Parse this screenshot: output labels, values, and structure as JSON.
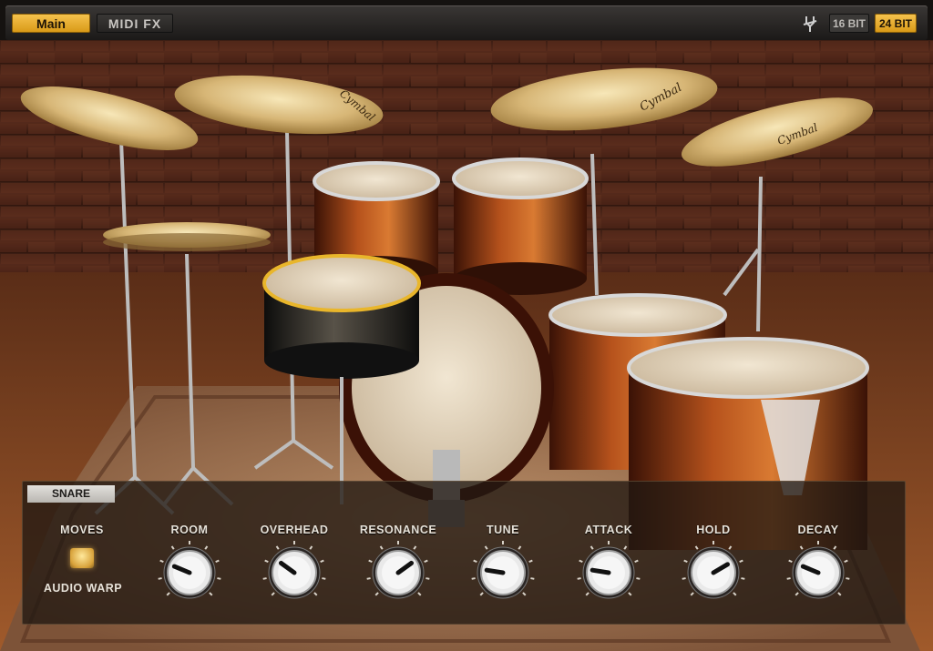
{
  "topbar": {
    "tabs": [
      "Main",
      "MIDI FX"
    ],
    "active_tab": "Main",
    "bit_16": "16 BIT",
    "bit_24": "24 BIT",
    "active_bit": "24 BIT"
  },
  "panel": {
    "instrument": "SNARE",
    "moves_label": "MOVES",
    "audio_warp_label": "AUDIO WARP",
    "knobs": [
      {
        "label": "ROOM",
        "value": 0.25
      },
      {
        "label": "OVERHEAD",
        "value": 0.3
      },
      {
        "label": "RESONANCE",
        "value": 0.7
      },
      {
        "label": "TUNE",
        "value": 0.2
      },
      {
        "label": "ATTACK",
        "value": 0.2
      },
      {
        "label": "HOLD",
        "value": 0.72
      },
      {
        "label": "DECAY",
        "value": 0.25
      }
    ]
  },
  "cymbal_brand": "Cymbal",
  "colors": {
    "accent": "#e8ad2e",
    "panel_bg": "#211812"
  }
}
